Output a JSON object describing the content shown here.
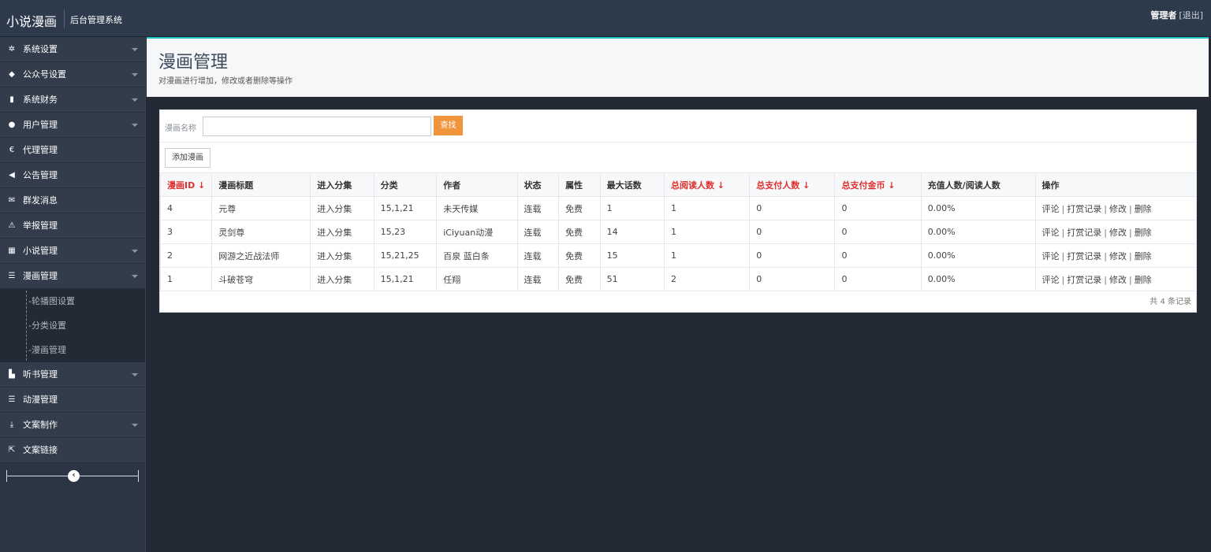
{
  "topbar": {
    "brand": "小说漫画",
    "subtitle": "后台管理系统",
    "user_name": "管理者",
    "logout": "[退出]"
  },
  "sidebar": {
    "items": [
      {
        "label": "系统设置",
        "icon": "gear-icon",
        "glyph": "✲",
        "caret": true
      },
      {
        "label": "公众号设置",
        "icon": "tags-icon",
        "glyph": "◆",
        "caret": true
      },
      {
        "label": "系统财务",
        "icon": "bar-chart-icon",
        "glyph": "▮",
        "caret": true
      },
      {
        "label": "用户管理",
        "icon": "user-icon",
        "glyph": "●",
        "caret": true
      },
      {
        "label": "代理管理",
        "icon": "euro-icon",
        "glyph": "€",
        "caret": false
      },
      {
        "label": "公告管理",
        "icon": "bullhorn-icon",
        "glyph": "◀",
        "caret": false
      },
      {
        "label": "群发消息",
        "icon": "envelope-icon",
        "glyph": "✉",
        "caret": false
      },
      {
        "label": "举报管理",
        "icon": "warning-icon",
        "glyph": "⚠",
        "caret": false
      },
      {
        "label": "小说管理",
        "icon": "grid-icon",
        "glyph": "▦",
        "caret": true
      },
      {
        "label": "漫画管理",
        "icon": "list-icon",
        "glyph": "☰",
        "caret": true
      }
    ],
    "sub_items": [
      "-轮播图设置",
      "-分类设置",
      "-漫画管理"
    ],
    "items_after": [
      {
        "label": "听书管理",
        "icon": "sitemap-icon",
        "glyph": "▙",
        "caret": true
      },
      {
        "label": "动漫管理",
        "icon": "list-icon",
        "glyph": "☰",
        "caret": false
      },
      {
        "label": "文案制作",
        "icon": "download-icon",
        "glyph": "⤓",
        "caret": true
      },
      {
        "label": "文案链接",
        "icon": "share-icon",
        "glyph": "⇱",
        "caret": false
      }
    ],
    "collapse_glyph": "‹"
  },
  "header": {
    "title": "漫画管理",
    "description": "对漫画进行增加，修改或者删除等操作"
  },
  "search": {
    "label": "漫画名称",
    "value": "",
    "placeholder": "",
    "button": "查找"
  },
  "add_button": "添加漫画",
  "table": {
    "columns": [
      {
        "label": "漫画ID ↓",
        "sort": true
      },
      {
        "label": "漫画标题",
        "sort": false
      },
      {
        "label": "进入分集",
        "sort": false
      },
      {
        "label": "分类",
        "sort": false
      },
      {
        "label": "作者",
        "sort": false
      },
      {
        "label": "状态",
        "sort": false
      },
      {
        "label": "属性",
        "sort": false
      },
      {
        "label": "最大话数",
        "sort": false
      },
      {
        "label": "总阅读人数 ↓",
        "sort": true
      },
      {
        "label": "总支付人数 ↓",
        "sort": true
      },
      {
        "label": "总支付金币 ↓",
        "sort": true
      },
      {
        "label": "充值人数/阅读人数",
        "sort": false
      },
      {
        "label": "操作",
        "sort": false
      }
    ],
    "rows": [
      {
        "id": "4",
        "title": "元尊",
        "enter": "进入分集",
        "category": "15,1,21",
        "author": "未天传媒",
        "status": "连载",
        "attr": "免费",
        "max": "1",
        "reads": "1",
        "payers": "0",
        "coins": "0",
        "ratio": "0.00%"
      },
      {
        "id": "3",
        "title": "灵剑尊",
        "enter": "进入分集",
        "category": "15,23",
        "author": "iCiyuan动漫",
        "status": "连载",
        "attr": "免费",
        "max": "14",
        "reads": "1",
        "payers": "0",
        "coins": "0",
        "ratio": "0.00%"
      },
      {
        "id": "2",
        "title": "网游之近战法师",
        "enter": "进入分集",
        "category": "15,21,25",
        "author": "百泉 蓝白条",
        "status": "连载",
        "attr": "免费",
        "max": "15",
        "reads": "1",
        "payers": "0",
        "coins": "0",
        "ratio": "0.00%"
      },
      {
        "id": "1",
        "title": "斗破苍穹",
        "enter": "进入分集",
        "category": "15,1,21",
        "author": "任翔",
        "status": "连载",
        "attr": "免费",
        "max": "51",
        "reads": "2",
        "payers": "0",
        "coins": "0",
        "ratio": "0.00%"
      }
    ],
    "actions": [
      "评论",
      "打赏记录",
      "修改",
      "删除"
    ],
    "action_sep": "|",
    "footer": "共 4 条记录"
  },
  "colors": {
    "topbar": "#2c3a4c",
    "accent": "#1ec2c2",
    "search_button": "#f0953c",
    "sort_header": "#e12f2f"
  }
}
